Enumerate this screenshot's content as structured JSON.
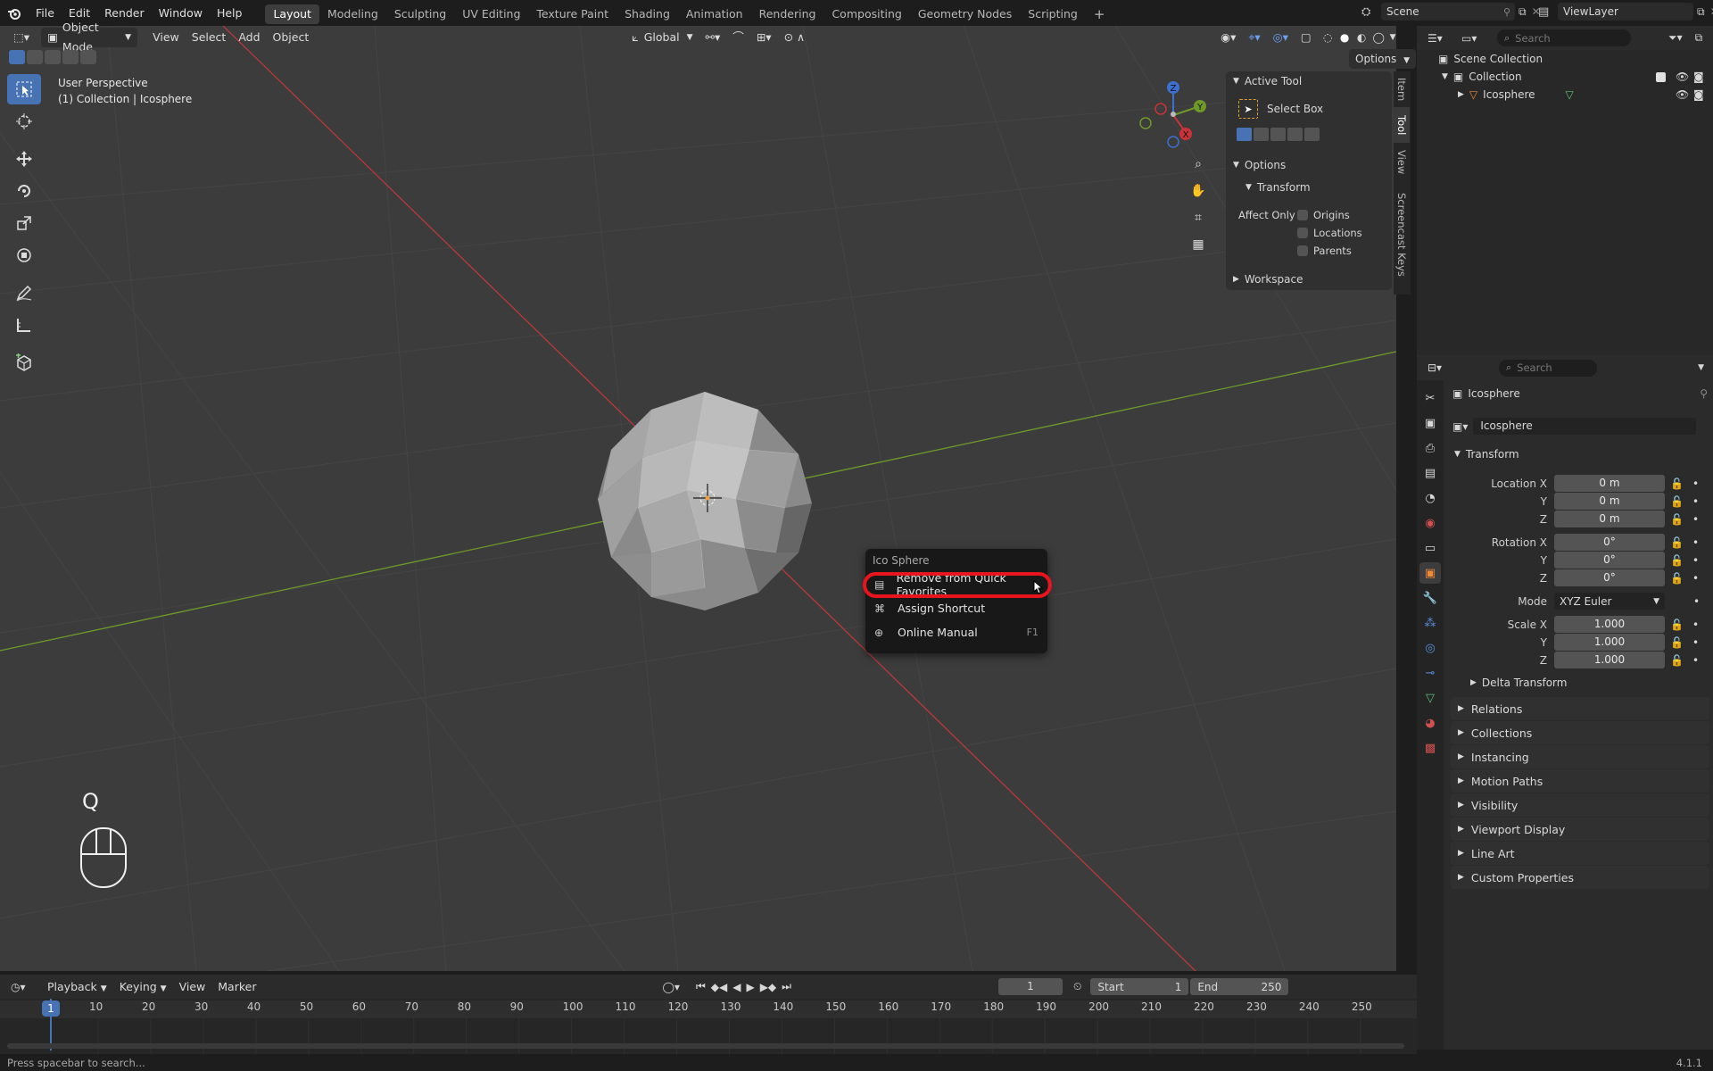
{
  "topbar": {
    "menus": [
      "File",
      "Edit",
      "Render",
      "Window",
      "Help"
    ],
    "workspaces": [
      "Layout",
      "Modeling",
      "Sculpting",
      "UV Editing",
      "Texture Paint",
      "Shading",
      "Animation",
      "Rendering",
      "Compositing",
      "Geometry Nodes",
      "Scripting"
    ],
    "active_workspace": "Layout",
    "add_tab": "+",
    "scene": "Scene",
    "view_layer": "ViewLayer"
  },
  "viewport": {
    "mode": "Object Mode",
    "menus": [
      "View",
      "Select",
      "Add",
      "Object"
    ],
    "orientation": "Global",
    "options_label": "Options",
    "overlay_title": "User Perspective",
    "overlay_subtitle": "(1) Collection | Icosphere",
    "key_display": "Q",
    "gizmo": {
      "z": "Z",
      "y": "Y",
      "x": "X"
    }
  },
  "npanel": {
    "active_tool_header": "Active Tool",
    "active_tool_name": "Select Box",
    "options_header": "Options",
    "transform_header": "Transform",
    "affect_only_label": "Affect Only",
    "affect_items": [
      "Origins",
      "Locations",
      "Parents"
    ],
    "workspace_header": "Workspace",
    "side_tabs": [
      "Item",
      "Tool",
      "View",
      "Screencast Keys"
    ]
  },
  "context_menu": {
    "title": "Ico Sphere",
    "items": [
      {
        "label": "Remove from Quick Favorites",
        "shortcut": "",
        "icon": "favorites-icon",
        "highlighted": true
      },
      {
        "label": "Assign Shortcut",
        "shortcut": "",
        "icon": "shortcut-icon",
        "highlighted": false
      },
      {
        "label": "Online Manual",
        "shortcut": "F1",
        "icon": "url-icon",
        "highlighted": false
      }
    ],
    "highlight_color": "#e8141e"
  },
  "outliner": {
    "search_placeholder": "Search",
    "scene_collection": "Scene Collection",
    "collection": "Collection",
    "object": "Icosphere"
  },
  "properties": {
    "search_placeholder": "Search",
    "object_name": "Icosphere",
    "object_field": "Icosphere",
    "transform_header": "Transform",
    "location": {
      "label_x": "Location X",
      "label_y": "Y",
      "label_z": "Z",
      "x": "0 m",
      "y": "0 m",
      "z": "0 m"
    },
    "rotation": {
      "label_x": "Rotation X",
      "label_y": "Y",
      "label_z": "Z",
      "x": "0°",
      "y": "0°",
      "z": "0°"
    },
    "mode_label": "Mode",
    "mode_value": "XYZ Euler",
    "scale": {
      "label_x": "Scale X",
      "label_y": "Y",
      "label_z": "Z",
      "x": "1.000",
      "y": "1.000",
      "z": "1.000"
    },
    "delta_transform": "Delta Transform",
    "sections": [
      "Relations",
      "Collections",
      "Instancing",
      "Motion Paths",
      "Visibility",
      "Viewport Display",
      "Line Art",
      "Custom Properties"
    ]
  },
  "timeline": {
    "menus": [
      "Playback",
      "Keying",
      "View",
      "Marker"
    ],
    "current_frame": "1",
    "start_label": "Start",
    "start": "1",
    "end_label": "End",
    "end": "250",
    "ticks": [
      "1",
      "10",
      "20",
      "30",
      "40",
      "50",
      "60",
      "70",
      "80",
      "90",
      "100",
      "110",
      "120",
      "130",
      "140",
      "150",
      "160",
      "170",
      "180",
      "190",
      "200",
      "210",
      "220",
      "230",
      "240",
      "250"
    ]
  },
  "statusbar": {
    "hint": "Press spacebar to search...",
    "version": "4.1.1"
  },
  "colors": {
    "accent": "#4772b3",
    "x_axis": "#b8383c",
    "y_axis": "#6f9a2a"
  }
}
